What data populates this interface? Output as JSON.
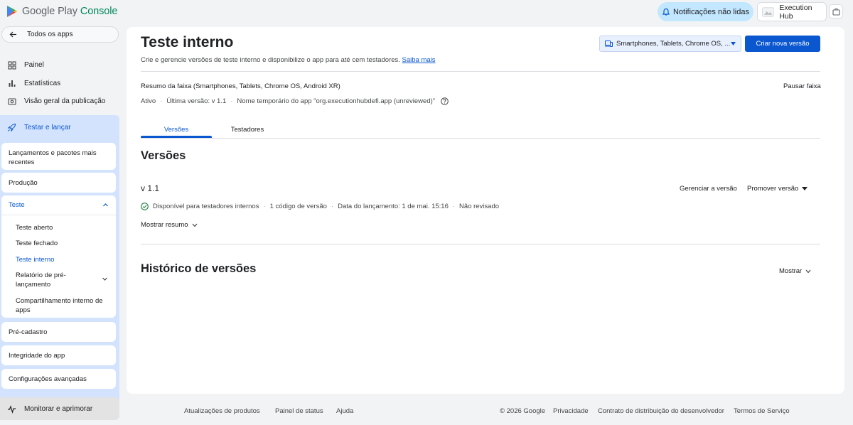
{
  "header": {
    "brand_main": "Google Play",
    "brand_accent": "Console",
    "notifications_label": "Notificações não lidas",
    "developer_name": "Execution Hub"
  },
  "sidebar": {
    "back_label": "Todos os apps",
    "top_items": [
      {
        "label": "Painel",
        "icon": "dashboard-icon"
      },
      {
        "label": "Estatísticas",
        "icon": "bar-chart-icon"
      },
      {
        "label": "Visão geral da publicação",
        "icon": "publishing-overview-icon"
      }
    ],
    "section": {
      "label": "Testar e lançar",
      "icon": "rocket-icon",
      "cards": {
        "latest": "Lançamentos e pacotes mais recentes",
        "production": "Produção",
        "testing": {
          "label": "Teste",
          "expanded": true,
          "items": [
            "Teste aberto",
            "Teste fechado",
            "Teste interno",
            "Relatório de pré-lançamento",
            "Compartilhamento interno de apps"
          ],
          "active_item": "Teste interno"
        },
        "pre_registration": "Pré-cadastro",
        "integrity": "Integridade do app",
        "advanced": "Configurações avançadas"
      }
    },
    "monitor": {
      "label": "Monitorar e aprimorar",
      "icon": "pulse-icon"
    }
  },
  "main": {
    "title": "Teste interno",
    "description": "Crie e gerencie versões de teste interno e disponibilize o app para até cem testadores.",
    "learn_more": "Saiba mais",
    "form_factor_select": "Smartphones, Tablets, Chrome OS, ...",
    "create_button": "Criar nova versão",
    "track_summary_title": "Resumo da faixa (Smartphones, Tablets, Chrome OS, Android XR)",
    "pause_track": "Pausar faixa",
    "track_meta": {
      "status": "Ativo",
      "latest_version": "Última versão: v 1.1",
      "temp_name": "Nome temporário do app \"org.executionhubdefi.app (unreviewed)\""
    },
    "tabs": [
      {
        "label": "Versões",
        "active": true
      },
      {
        "label": "Testadores",
        "active": false
      }
    ],
    "versions_heading": "Versões",
    "version": {
      "name": "v 1.1",
      "manage": "Gerenciar a versão",
      "promote": "Promover versão",
      "status": "Disponível para testadores internos",
      "code_count": "1 código de versão",
      "release_date": "Data do lançamento: 1 de mai. 15:16",
      "review": "Não revisado",
      "show_summary": "Mostrar resumo"
    },
    "history_heading": "Histórico de versões",
    "show_label": "Mostrar"
  },
  "footer": {
    "links": [
      "Atualizações de produtos",
      "Painel de status",
      "Ajuda"
    ],
    "copyright": "© 2026 Google",
    "right_links": [
      "Privacidade",
      "Contrato de distribuição do desenvolvedor",
      "Termos de Serviço"
    ]
  },
  "colors": {
    "accent_blue": "#0b57d0",
    "brand_green": "#01875f",
    "nav_selected_bg": "#d3e3fd",
    "notif_bg": "#c2e7ff",
    "success_green": "#188038"
  }
}
